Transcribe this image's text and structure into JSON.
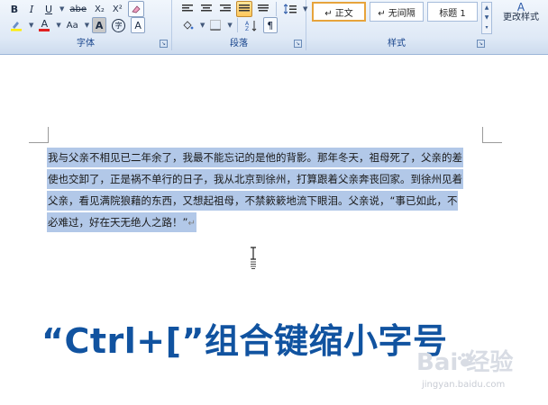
{
  "ribbon": {
    "font_group": {
      "label": "字体",
      "row1": [
        "B",
        "I",
        "U",
        "abe",
        "X₂",
        "X²"
      ],
      "row2": [
        "A",
        "Aa",
        "A",
        "A",
        "A"
      ]
    },
    "paragraph_group": {
      "label": "段落"
    },
    "styles_group": {
      "label": "样式",
      "styles": [
        "↵ 正文",
        "↵ 无间隔",
        "标题 1"
      ],
      "selected_index": 0,
      "change_styles": "更改样式"
    }
  },
  "document": {
    "lines": [
      "我与父亲不相见已二年余了，我最不能忘记的是他的背影。那年冬天，祖母死了，父亲的差",
      "使也交卸了，正是祸不单行的日子，我从北京到徐州，打算跟着父亲奔丧回家。到徐州见着",
      "父亲，看见满院狼藉的东西，又想起祖母，不禁簌簌地流下眼泪。父亲说，“事已如此，不",
      "必难过，好在天无绝人之路！”"
    ],
    "paragraph_mark": "↵"
  },
  "caption": "“Ctrl+[”组合键缩小字号",
  "watermark": {
    "main": "Bai  经验",
    "sub": "jingyan.baidu.com"
  },
  "colors": {
    "selection": "#b2c8e8",
    "caption": "#1153a0",
    "ribbon_label": "#15428b"
  }
}
